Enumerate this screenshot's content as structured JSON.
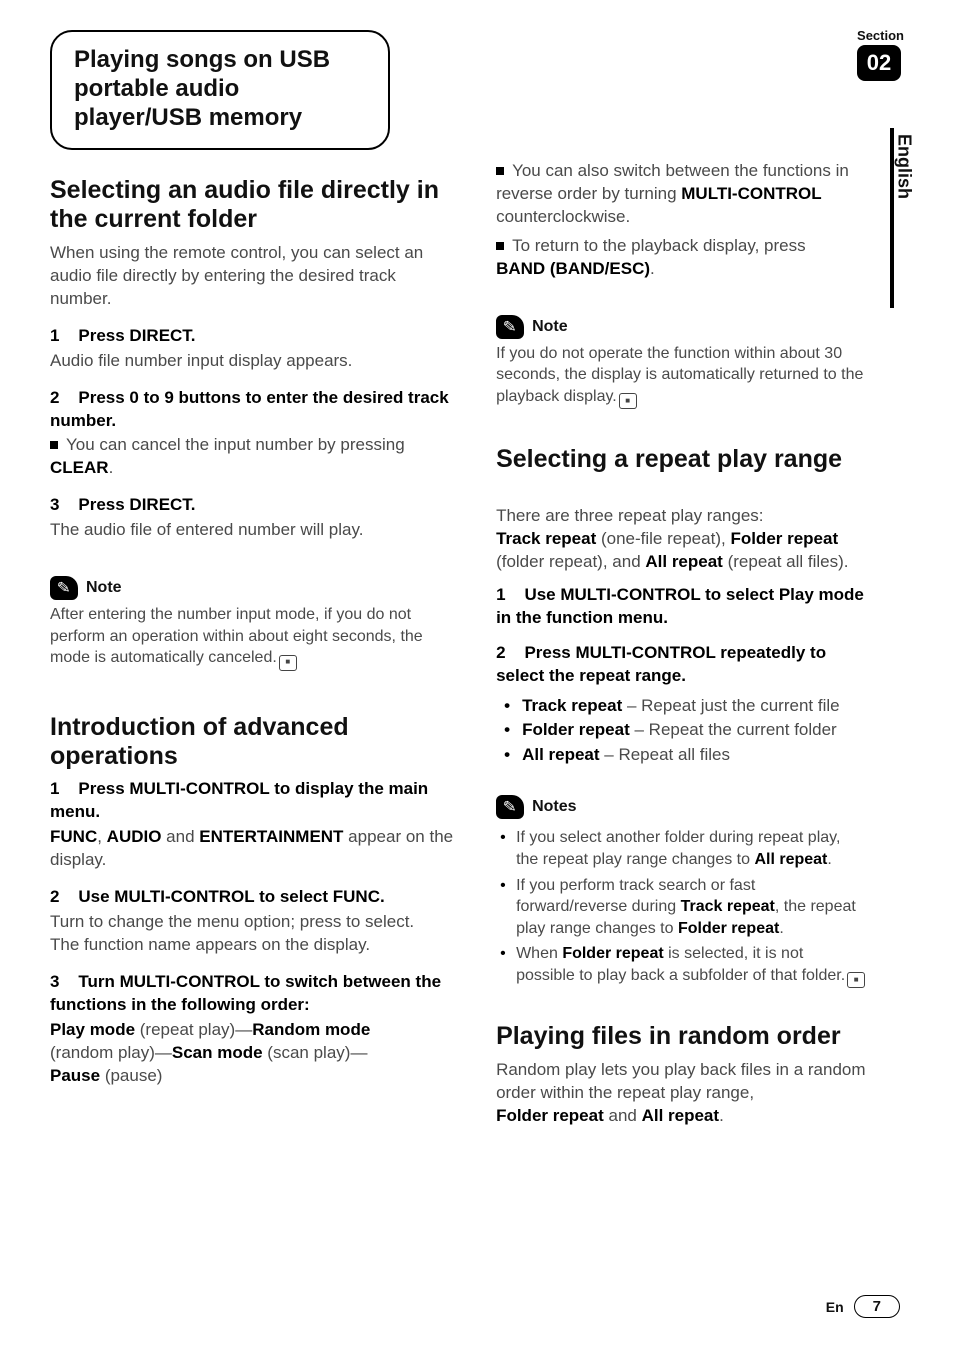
{
  "meta": {
    "section_label": "Section",
    "section_number": "02",
    "language_tab": "English",
    "footer_lang": "En",
    "page_number": "7"
  },
  "chapter": {
    "title": "Playing songs on USB portable audio player/USB memory"
  },
  "left": {
    "h1": "Selecting an audio file directly in the current folder",
    "p1": "When using the remote control, you can select an audio file directly by entering the desired track number.",
    "s1_num": "1",
    "s1_head": "Press DIRECT.",
    "s1_sub": "Audio file number input display appears.",
    "s2_num": "2",
    "s2_head": "Press 0 to 9 buttons to enter the desired track number.",
    "s2_bullet_pre": "You can cancel the input number by pressing ",
    "s2_bullet_bold": "CLEAR",
    "s2_bullet_post": ".",
    "s3_num": "3",
    "s3_head": "Press DIRECT.",
    "s3_sub": "The audio file of entered number will play.",
    "note_label": "Note",
    "note_body": "After entering the number input mode, if you do not perform an operation within about eight seconds, the mode is automatically canceled.",
    "h2": "Introduction of advanced operations",
    "adv_s1_num": "1",
    "adv_s1_head": "Press MULTI-CONTROL to display the main menu.",
    "adv_s1_sub_pre": "",
    "adv_s1_sub_b1": "FUNC",
    "adv_s1_sub_mid1": ", ",
    "adv_s1_sub_b2": "AUDIO",
    "adv_s1_sub_mid2": " and ",
    "adv_s1_sub_b3": "ENTERTAINMENT",
    "adv_s1_sub_post": " appear on the display.",
    "adv_s2_num": "2",
    "adv_s2_head": "Use MULTI-CONTROL to select FUNC.",
    "adv_s2_sub": "Turn to change the menu option; press to select.\nThe function name appears on the display.",
    "adv_s3_num": "3",
    "adv_s3_head": "Turn MULTI-CONTROL to switch between the functions in the following order:",
    "adv_s3_line_b1": "Play mode",
    "adv_s3_line_t1": " (repeat play)—",
    "adv_s3_line_b2": "Random mode",
    "adv_s3_line_t2": " (random play)—",
    "adv_s3_line_b3": "Scan mode",
    "adv_s3_line_t3": " (scan play)—",
    "adv_s3_line_b4": "Pause",
    "adv_s3_line_t4": " (pause)"
  },
  "right": {
    "bullet1_pre": "You can also switch between the functions in reverse order by turning ",
    "bullet1_bold": "MULTI-CONTROL",
    "bullet1_post": " counterclockwise.",
    "bullet2_pre": "To return to the playback display, press ",
    "bullet2_bold": "BAND (BAND/ESC)",
    "bullet2_post": ".",
    "note_label": "Note",
    "note_body": "If you do not operate the function within about 30 seconds, the display is automatically returned to the playback display.",
    "h3": "Selecting a repeat play range",
    "p3_pre": "There are three repeat play ranges:\n",
    "p3_b1": "Track repeat",
    "p3_t1": " (one-file repeat), ",
    "p3_b2": "Folder repeat",
    "p3_t2": " (folder repeat), and ",
    "p3_b3": "All repeat",
    "p3_t3": " (repeat all files).",
    "rp_s1_num": "1",
    "rp_s1_head": "Use MULTI-CONTROL to select Play mode in the function menu.",
    "rp_s2_num": "2",
    "rp_s2_head": "Press MULTI-CONTROL repeatedly to select the repeat range.",
    "opts": [
      {
        "b": "Track repeat",
        "t": " – Repeat just the current file"
      },
      {
        "b": "Folder repeat",
        "t": " – Repeat the current folder"
      },
      {
        "b": "All repeat",
        "t": " – Repeat all files"
      }
    ],
    "notes_label": "Notes",
    "notes": {
      "n1_pre": "If you select another folder during repeat play, the repeat play range changes to ",
      "n1_b": "All repeat",
      "n1_post": ".",
      "n2_pre": "If you perform track search or fast forward/reverse during ",
      "n2_b": "Track repeat",
      "n2_mid": ", the repeat play range changes to ",
      "n2_b2": "Folder repeat",
      "n2_post": ".",
      "n3_pre": "When ",
      "n3_b": "Folder repeat",
      "n3_post": " is selected, it is not possible to play back a subfolder of that folder."
    },
    "h4": "Playing files in random order",
    "p4_pre": "Random play lets you play back files in a random order within the repeat play range, ",
    "p4_b1": "Folder repeat",
    "p4_mid": " and ",
    "p4_b2": "All repeat",
    "p4_post": "."
  }
}
